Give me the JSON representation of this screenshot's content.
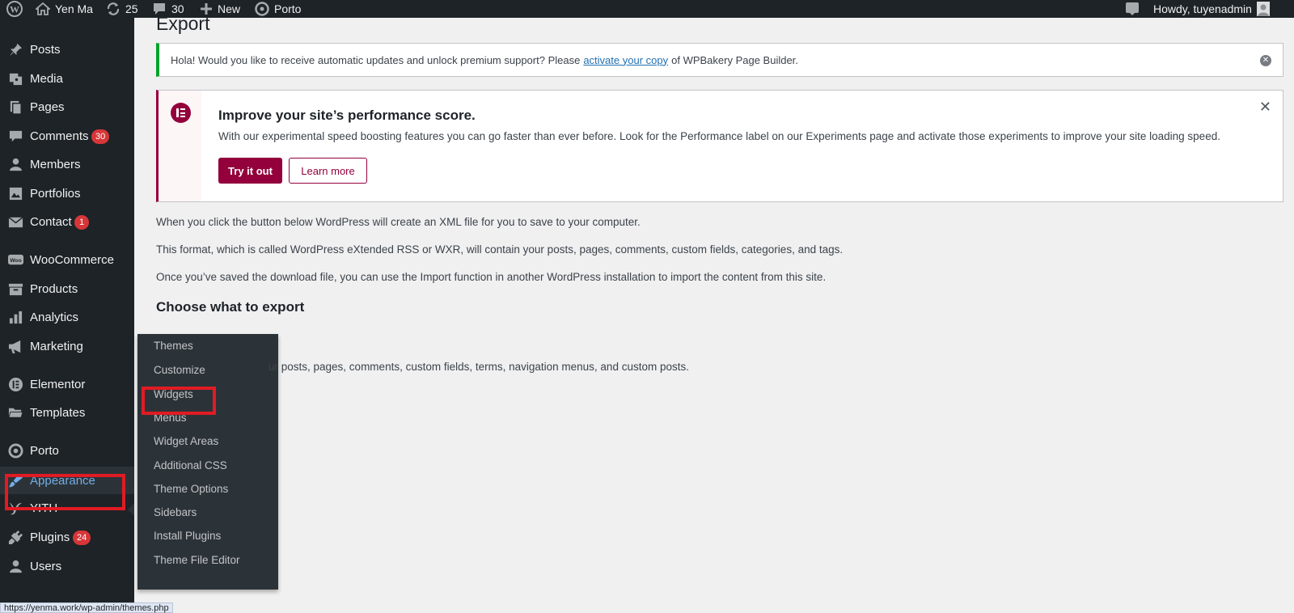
{
  "adminbar": {
    "site_name": "Yen Ma",
    "updates_count": "25",
    "comments_count": "30",
    "new_label": "New",
    "theme_label": "Porto",
    "howdy": "Howdy, tuyenadmin"
  },
  "sidebar": {
    "items": [
      {
        "label": "Posts",
        "icon": "pushpin-icon"
      },
      {
        "label": "Media",
        "icon": "media-icon"
      },
      {
        "label": "Pages",
        "icon": "pages-icon"
      },
      {
        "label": "Comments",
        "icon": "comment-icon",
        "badge": "30"
      },
      {
        "label": "Members",
        "icon": "user-icon"
      },
      {
        "label": "Portfolios",
        "icon": "portfolio-icon"
      },
      {
        "label": "Contact",
        "icon": "mail-icon",
        "badge": "1"
      },
      {
        "label": "WooCommerce",
        "icon": "woo-icon"
      },
      {
        "label": "Products",
        "icon": "archive-icon"
      },
      {
        "label": "Analytics",
        "icon": "chart-icon"
      },
      {
        "label": "Marketing",
        "icon": "megaphone-icon"
      },
      {
        "label": "Elementor",
        "icon": "elementor-icon"
      },
      {
        "label": "Templates",
        "icon": "folder-icon"
      },
      {
        "label": "Porto",
        "icon": "porto-icon"
      },
      {
        "label": "Appearance",
        "icon": "brush-icon",
        "active": true
      },
      {
        "label": "YITH",
        "icon": "yith-icon"
      },
      {
        "label": "Plugins",
        "icon": "plug-icon",
        "badge": "24"
      },
      {
        "label": "Users",
        "icon": "user-icon"
      }
    ]
  },
  "flyout": {
    "items": [
      "Themes",
      "Customize",
      "Widgets",
      "Menus",
      "Widget Areas",
      "Additional CSS",
      "Theme Options",
      "Sidebars",
      "Install Plugins",
      "Theme File Editor"
    ]
  },
  "main": {
    "title": "Export",
    "wpb_notice": {
      "before": "Hola! Would you like to receive automatic updates and unlock premium support? Please",
      "link": "activate your copy",
      "after": "of WPBakery Page Builder."
    },
    "elementor_notice": {
      "title": "Improve your site’s performance score.",
      "description": "With our experimental speed boosting features you can go faster than ever before. Look for the Performance label on our Experiments page and activate those experiments to improve your site loading speed.",
      "primary_btn": "Try it out",
      "secondary_btn": "Learn more",
      "close": "✕"
    },
    "paragraphs": [
      "When you click the button below WordPress will create an XML file for you to save to your computer.",
      "This format, which is called WordPress eXtended RSS or WXR, will contain your posts, pages, comments, custom fields, categories, and tags.",
      "Once you’ve saved the download file, you can use the Import function in another WordPress installation to import the content from this site."
    ],
    "section_title": "Choose what to export",
    "partial_text": "ur posts, pages, comments, custom fields, terms, navigation menus, and custom posts."
  },
  "status_url": "https://yenma.work/wp-admin/themes.php",
  "colors": {
    "admin_bg": "#1d2327",
    "accent_blue": "#72aee6",
    "elementor": "#93003c",
    "highlight": "#e01b24",
    "badge": "#d63638"
  }
}
